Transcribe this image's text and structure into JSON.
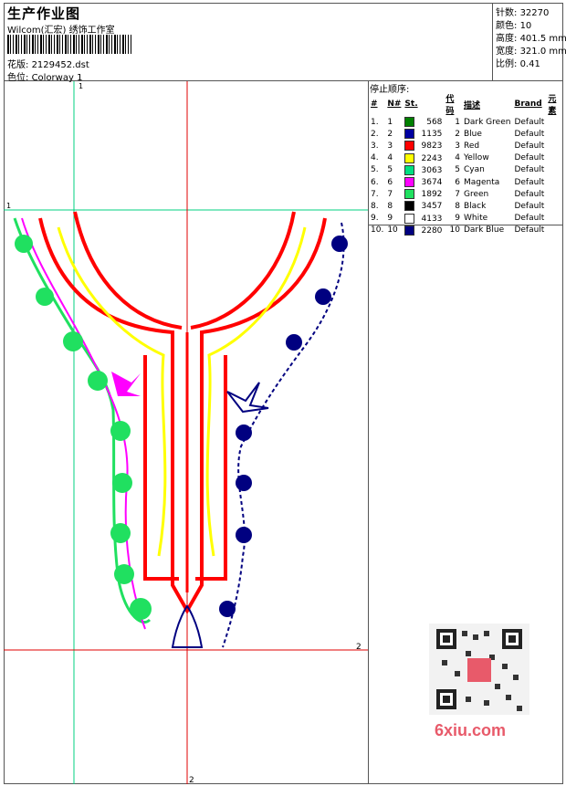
{
  "header": {
    "title": "生产作业图",
    "company": "Wilcom(汇宏) 绣饰工作室",
    "design_file_label": "花版:",
    "design_file": "2129452.dst",
    "colorway_label": "色位:",
    "colorway": "Colorway 1"
  },
  "stats": [
    {
      "label": "针数:",
      "value": "32270"
    },
    {
      "label": "颜色:",
      "value": "10"
    },
    {
      "label": "高度:",
      "value": "401.5 mm"
    },
    {
      "label": "宽度:",
      "value": "321.0 mm"
    },
    {
      "label": "比例:",
      "value": "0.41"
    }
  ],
  "guide_labels": {
    "top_left": "1",
    "top_side": "1",
    "bottom_right": "2",
    "bottom": "2"
  },
  "stop_sequence": {
    "title": "停止顺序:",
    "columns": [
      "#",
      "N#",
      "St.",
      "代码",
      "描述",
      "Brand",
      "元素"
    ],
    "rows": [
      {
        "idx": "1.",
        "n": "1",
        "color": "#008000",
        "st": "568",
        "code": "1",
        "desc": "Dark Green",
        "brand": "Default"
      },
      {
        "idx": "2.",
        "n": "2",
        "color": "#0000a0",
        "st": "1135",
        "code": "2",
        "desc": "Blue",
        "brand": "Default"
      },
      {
        "idx": "3.",
        "n": "3",
        "color": "#ff0000",
        "st": "9823",
        "code": "3",
        "desc": "Red",
        "brand": "Default"
      },
      {
        "idx": "4.",
        "n": "4",
        "color": "#ffff00",
        "st": "2243",
        "code": "4",
        "desc": "Yellow",
        "brand": "Default"
      },
      {
        "idx": "5.",
        "n": "5",
        "color": "#00e080",
        "st": "3063",
        "code": "5",
        "desc": "Cyan",
        "brand": "Default"
      },
      {
        "idx": "6.",
        "n": "6",
        "color": "#ff00ff",
        "st": "3674",
        "code": "6",
        "desc": "Magenta",
        "brand": "Default"
      },
      {
        "idx": "7.",
        "n": "7",
        "color": "#20e060",
        "st": "1892",
        "code": "7",
        "desc": "Green",
        "brand": "Default"
      },
      {
        "idx": "8.",
        "n": "8",
        "color": "#000000",
        "st": "3457",
        "code": "8",
        "desc": "Black",
        "brand": "Default"
      },
      {
        "idx": "9.",
        "n": "9",
        "color": "#ffffff",
        "st": "4133",
        "code": "9",
        "desc": "White",
        "brand": "Default"
      },
      {
        "idx": "10.",
        "n": "10",
        "color": "#000080",
        "st": "2280",
        "code": "10",
        "desc": "Dark Blue",
        "brand": "Default"
      }
    ]
  },
  "watermark": {
    "site": "6xiu.com"
  },
  "colors": {
    "guide_green": "#00d080",
    "guide_red": "#e00000",
    "border": "#555555"
  }
}
